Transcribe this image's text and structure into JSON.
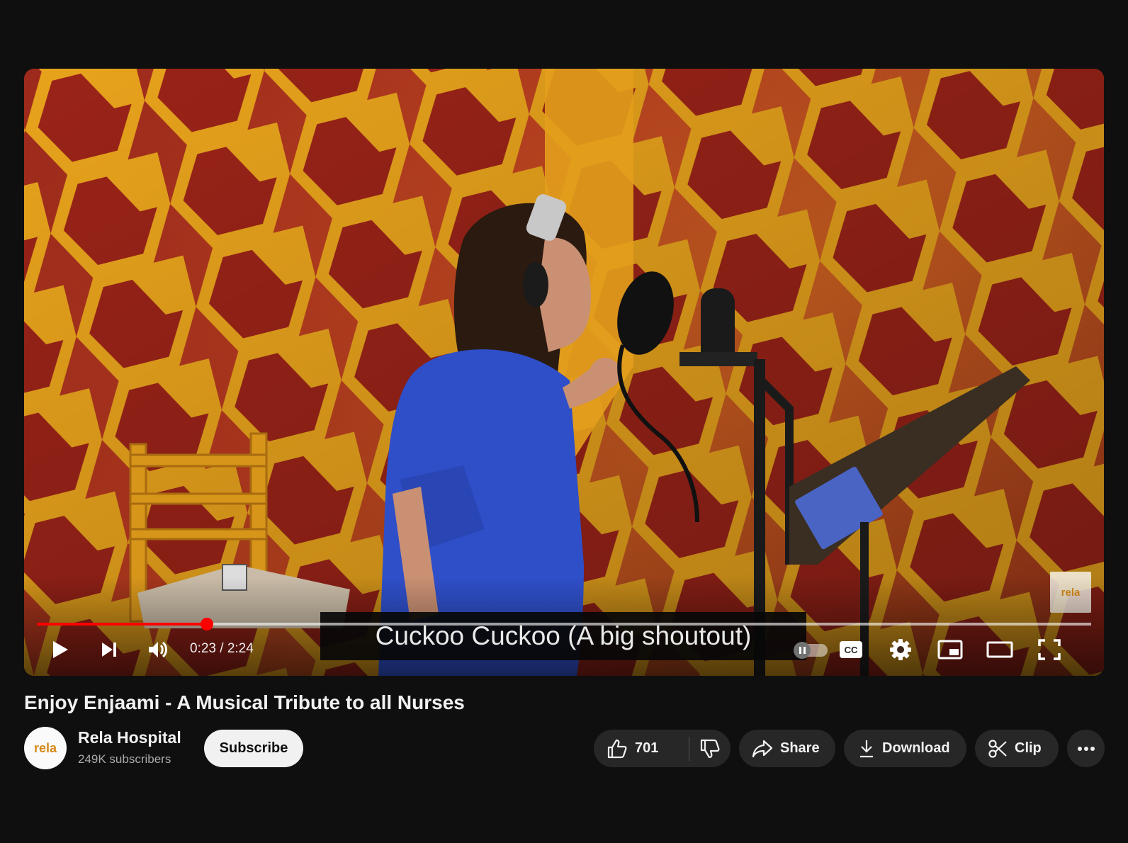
{
  "player": {
    "subtitle": "Cuckoo Cuckoo (A big shoutout)",
    "time_display": "0:23 / 2:24",
    "progress_played_fraction": 0.161,
    "progress_loaded_fraction": 1.0,
    "watermark_logo": "rela",
    "controls": {
      "play_icon": "play-icon",
      "next_icon": "next-icon",
      "volume_icon": "volume-icon",
      "autoplay_icon": "autoplay-toggle",
      "captions_icon": "cc-icon",
      "settings_icon": "gear-icon",
      "miniplayer_icon": "miniplayer-icon",
      "theater_icon": "theater-icon",
      "fullscreen_icon": "fullscreen-icon"
    },
    "accent_color": "#ff0000"
  },
  "video": {
    "title": "Enjoy Enjaami - A Musical Tribute to all Nurses"
  },
  "channel": {
    "name": "Rela Hospital",
    "subscribers": "249K subscribers",
    "avatar_logo": "rela",
    "subscribe_label": "Subscribe"
  },
  "actions": {
    "like_count": "701",
    "share_label": "Share",
    "download_label": "Download",
    "clip_label": "Clip"
  }
}
